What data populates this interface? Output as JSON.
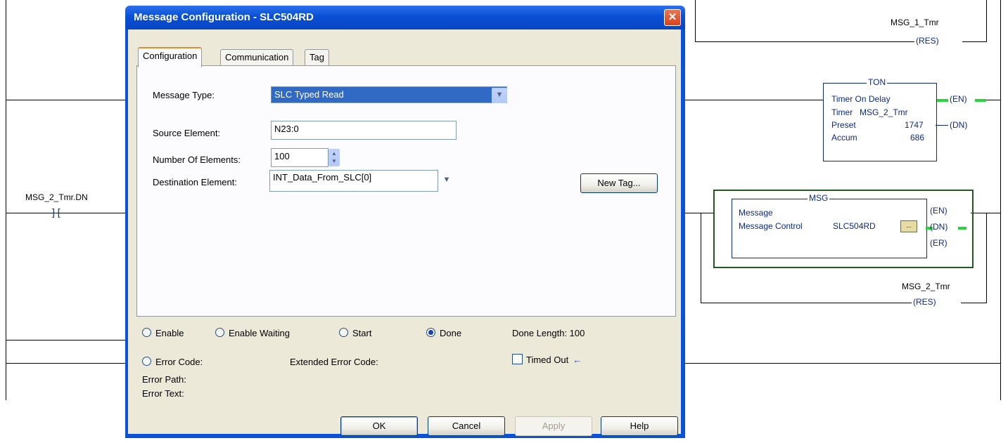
{
  "dialog": {
    "title": "Message Configuration - SLC504RD",
    "close_glyph": "✕",
    "tabs": [
      "Configuration",
      "Communication",
      "Tag"
    ],
    "message_type_label": "Message Type:",
    "message_type_value": "SLC Typed Read",
    "source_element_label": "Source Element:",
    "source_element_value": "N23:0",
    "num_elements_label": "Number Of Elements:",
    "num_elements_value": "100",
    "destination_label": "Destination Element:",
    "destination_value": "INT_Data_From_SLC[0]",
    "new_tag_button": "New Tag...",
    "status": {
      "enable": "Enable",
      "enable_waiting": "Enable Waiting",
      "start": "Start",
      "done": "Done",
      "done_length": "Done Length: 100",
      "error_code": "Error Code:",
      "extended_error_code": "Extended Error Code:",
      "timed_out": "Timed Out",
      "error_path": "Error Path:",
      "error_text": "Error Text:"
    },
    "buttons": {
      "ok": "OK",
      "cancel": "Cancel",
      "apply": "Apply",
      "help": "Help"
    }
  },
  "ladder": {
    "contact_tag": "MSG_2_Tmr.DN",
    "res1_tag": "MSG_1_Tmr",
    "res_coil": "(RES)",
    "ton": {
      "header": "TON",
      "title": "Timer On Delay",
      "timer_label": "Timer",
      "timer_value": "MSG_2_Tmr",
      "preset_label": "Preset",
      "preset_value": "1747",
      "accum_label": "Accum",
      "accum_value": "686",
      "en": "(EN)",
      "dn": "(DN)"
    },
    "msg": {
      "header": "MSG",
      "title": "Message",
      "control_label": "Message Control",
      "control_value": "SLC504RD",
      "browse_glyph": "...",
      "en": "(EN)",
      "dn": "(DN)",
      "er": "(ER)"
    },
    "res2_tag": "MSG_2_Tmr"
  },
  "colors": {
    "title_blue": "#0a53d8",
    "dialog_face": "#ece9d8",
    "rung_green": "#27d63a",
    "ladder_blue": "#0a2a8c"
  }
}
